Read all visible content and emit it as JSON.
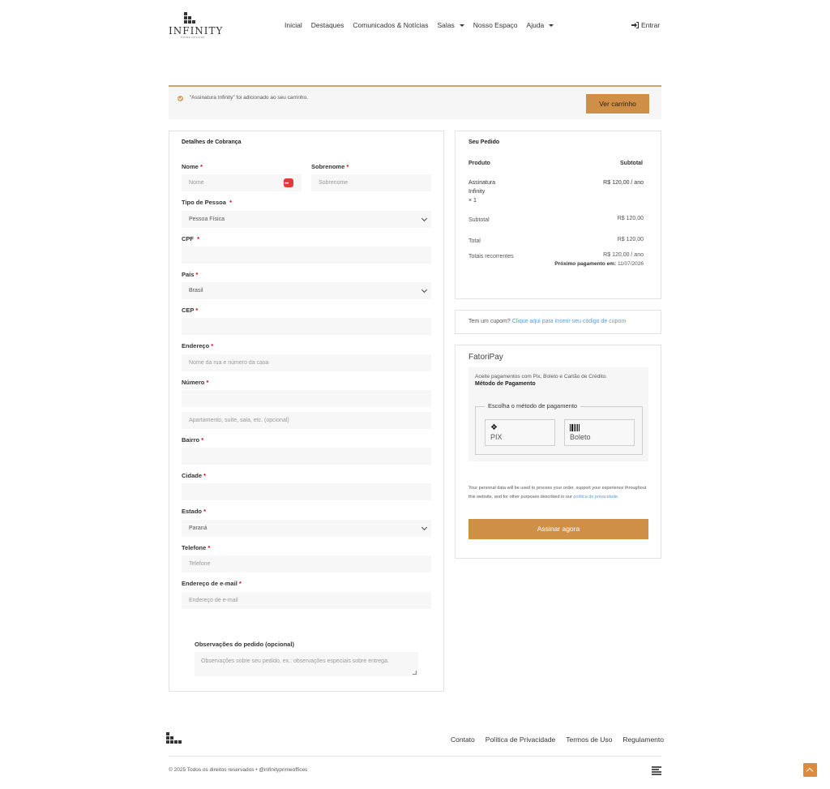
{
  "header": {
    "brand": "INFINITY",
    "brand_sub": "PRIME OFFICES",
    "nav": [
      "Inicial",
      "Destaques",
      "Comunicados & Notícias",
      "Salas",
      "Nosso Espaço",
      "Ajuda"
    ],
    "login": "Entrar"
  },
  "notice": {
    "message": "“Assinatura Infinity” foi adicionado ao seu carrinho.",
    "button": "Ver carrinho"
  },
  "billing": {
    "title": "Detalhes de Cobrança",
    "nome_label": "Nome",
    "nome_placeholder": "Nome",
    "sobrenome_label": "Sobrenome",
    "sobrenome_placeholder": "Sobrenome",
    "tipo_label": "Tipo de Pessoa",
    "tipo_value": "Pessoa Física",
    "cpf_label": "CPF",
    "pais_label": "País",
    "pais_value": "Brasil",
    "cep_label": "CEP",
    "endereco_label": "Endereço",
    "endereco_placeholder": "Nome da rua e número da casa",
    "numero_label": "Número",
    "complemento_placeholder": "Apartamento, suíte, sala, etc. (opcional)",
    "bairro_label": "Bairro",
    "cidade_label": "Cidade",
    "estado_label": "Estado",
    "estado_value": "Paraná",
    "telefone_label": "Telefone",
    "telefone_placeholder": "Telefone",
    "email_label": "Endereço de e-mail",
    "email_placeholder": "Endereço de e-mail",
    "obs_label": "Observações do pedido (opcional)",
    "obs_placeholder": "Observações sobre seu pedido, ex.: observações especiais sobre entrega.",
    "required_mark": "*"
  },
  "order": {
    "title": "Seu Pedido",
    "col_product": "Produto",
    "col_subtotal": "Subtotal",
    "item_line1": "Assinatura",
    "item_line2": "Infinity",
    "item_qty": "× 1",
    "item_price": "R$ 120,00 / ano",
    "subtotal_label": "Subtotal",
    "subtotal_value": "R$ 120,00",
    "total_label": "Total",
    "total_value": "R$ 120,00",
    "recurring_label": "Totais recorrentes",
    "recurring_value": "R$ 120,00 / ano",
    "next_payment_label": "Próximo pagamento em:",
    "next_payment_date": "11/07/2026"
  },
  "coupon": {
    "text": "Tem um cupom?",
    "link": "Clique aqui para inserir seu código de cupom"
  },
  "payment": {
    "title": "FatoriPay",
    "desc": "Aceite pagamentos com Pix, Boleto e Cartão de Crédito.",
    "method_title": "Método de Pagamento",
    "legend": "Escolha o método de pagamento",
    "opt_pix": "PIX",
    "opt_boleto": "Boleto",
    "privacy_text": "Your personal data will be used to process your order, support your experience throughout this website, and for other purposes described in our",
    "privacy_link": "política de privacidade.",
    "submit": "Assinar agora"
  },
  "footer": {
    "links": [
      "Contato",
      "Política de Privacidade",
      "Termos de Uso",
      "Regulamento"
    ],
    "copyright": "© 2025 Todos os direitos reservados • @infinityprimeoffices"
  },
  "colors": {
    "accent": "#d08f47",
    "notice_border": "#d4a35f",
    "link": "#5b9bd5",
    "required": "#d0021b"
  }
}
